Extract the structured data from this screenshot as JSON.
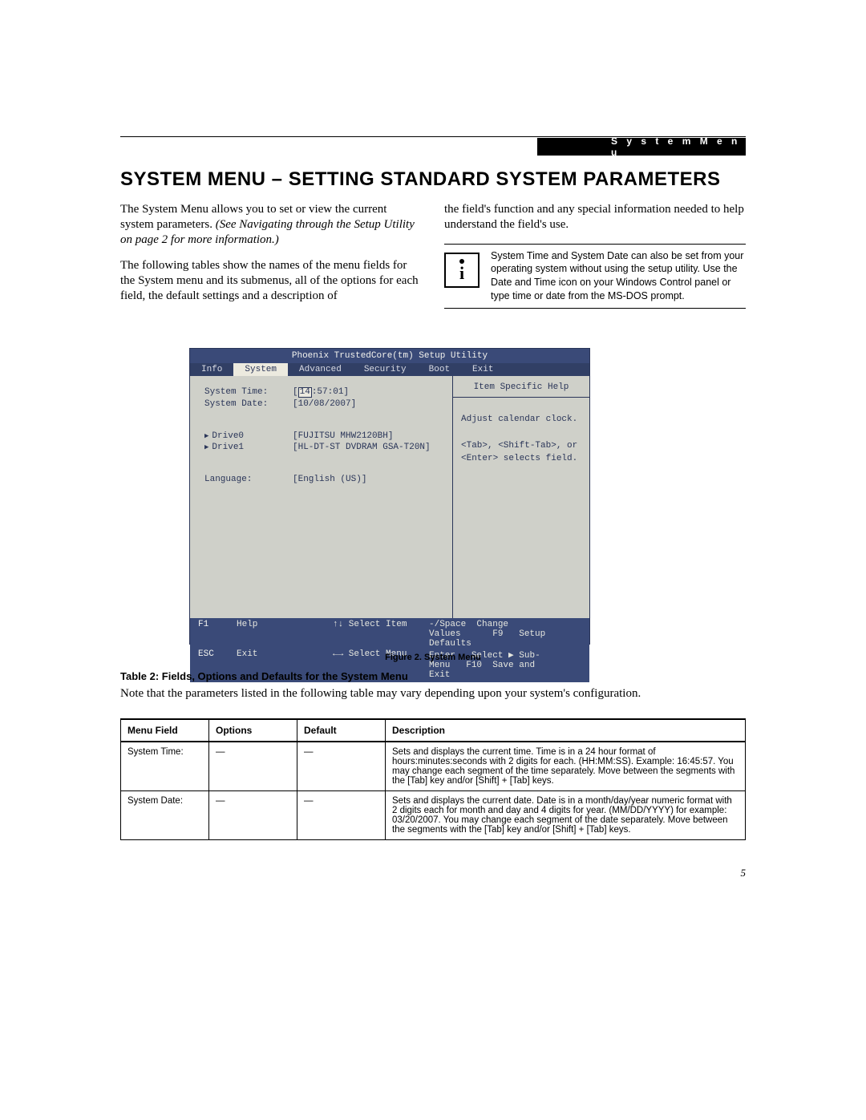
{
  "header": {
    "section_badge": "S y s t e m   M e n u",
    "title": "SYSTEM MENU – SETTING STANDARD SYSTEM PARAMETERS"
  },
  "paragraphs": {
    "p1a": "The System Menu allows you to set or view the current system parameters. ",
    "p1b": "(See Navigating through the Setup Utility on page 2 for more information.)",
    "p2": "The following tables show the names of the menu fields for the System menu and its submenus, all of the options for each field, the default settings and a description of",
    "p3": "the field's function and any special information needed to help understand the field's use.",
    "note": "System Time and System Date can also be set from your operating system without using the setup utility. Use the Date and Time icon on your Windows Control panel or type time or date from the MS-DOS prompt."
  },
  "bios": {
    "title": "Phoenix TrustedCore(tm) Setup Utility",
    "menubar": [
      "Info",
      "System",
      "Advanced",
      "Security",
      "Boot",
      "Exit"
    ],
    "selected_tab": "System",
    "fields": {
      "system_time_label": "System Time:",
      "system_time_value_prefix": "14",
      "system_time_value_rest": ":57:01]",
      "system_date_label": "System Date:",
      "system_date_value": "[10/08/2007]",
      "drive0_label": "Drive0",
      "drive0_value": "[FUJITSU MHW2120BH]",
      "drive1_label": "Drive1",
      "drive1_value": "[HL-DT-ST DVDRAM GSA-T20N]",
      "language_label": "Language:",
      "language_value": "[English (US)]"
    },
    "help": {
      "title": "Item Specific Help",
      "line1": "Adjust calendar clock.",
      "line2": "<Tab>, <Shift-Tab>, or",
      "line3": "<Enter> selects field."
    },
    "footer": {
      "f1": "F1",
      "f1l": "Help",
      "esc": "ESC",
      "escl": "Exit",
      "ud": "↑↓ Select Item",
      "lr": "←→ Select Menu",
      "sp": "-/Space",
      "spl": "Change Values",
      "en": "Enter",
      "enl": "Select ▶ Sub-Menu",
      "f9": "F9",
      "f9l": "Setup Defaults",
      "f10": "F10",
      "f10l": "Save and Exit"
    }
  },
  "figure_caption": "Figure 2.   System Menu",
  "table_caption": "Table 2: Fields, Options and Defaults for the System Menu",
  "table_note": "Note that the parameters listed in the following table may vary depending upon your system's configuration.",
  "table": {
    "headers": [
      "Menu Field",
      "Options",
      "Default",
      "Description"
    ],
    "rows": [
      {
        "field": "System Time:",
        "options": "—",
        "default": "—",
        "desc": "Sets and displays the current time. Time is in a 24 hour format of hours:minutes:seconds with 2 digits for each. (HH:MM:SS). Example: 16:45:57. You may change each segment of the time separately. Move between the segments with the [Tab] key and/or [Shift] + [Tab] keys."
      },
      {
        "field": "System Date:",
        "options": "—",
        "default": "—",
        "desc": "Sets and displays the current date. Date is in a month/day/year numeric format with 2 digits each for month and day and 4 digits for year. (MM/DD/YYYY) for example: 03/20/2007. You may change each segment of the date separately. Move between the segments with the [Tab] key and/or [Shift] + [Tab] keys."
      }
    ]
  },
  "page_number": "5"
}
